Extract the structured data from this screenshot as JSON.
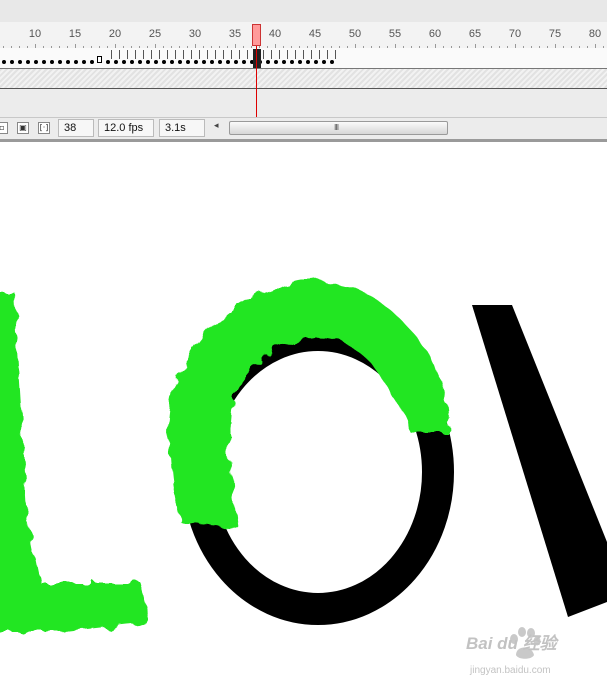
{
  "timeline": {
    "ruler_labels": [
      "10",
      "15",
      "20",
      "25",
      "30",
      "35",
      "40",
      "45",
      "50",
      "55",
      "60",
      "65",
      "70",
      "75",
      "80"
    ],
    "current_frame": "38",
    "frame_rate": "12.0 fps",
    "elapsed_time": "3.1s",
    "scroll_grip": "III"
  },
  "stage": {
    "text_colors": {
      "stroke": "#000000",
      "brush": "#22e622"
    }
  },
  "watermark": {
    "brand": "Bai du 经验",
    "site": "jingyan.baidu.com"
  }
}
